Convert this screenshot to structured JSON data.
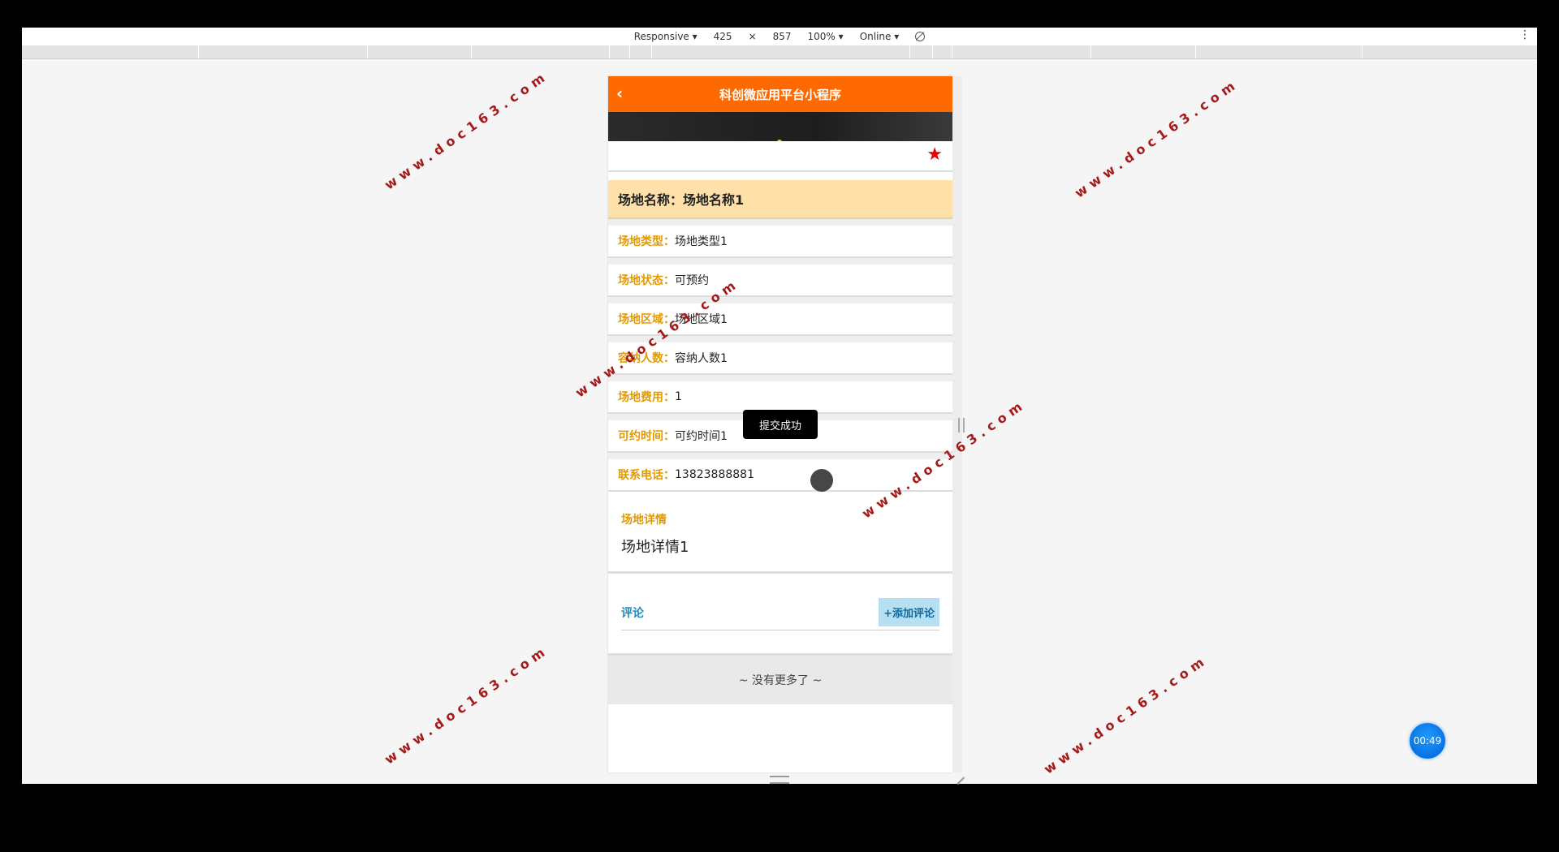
{
  "devtools": {
    "mode": "Responsive ▾",
    "width": "425",
    "times": "×",
    "height": "857",
    "zoom": "100% ▾",
    "network": "Online ▾",
    "menu": "⋮"
  },
  "app": {
    "title": "科创微应用平台小程序",
    "back_icon": "‹"
  },
  "venue": {
    "name_text": "场地名称：场地名称1",
    "fields": [
      {
        "label": "场地类型：",
        "value": "场地类型1"
      },
      {
        "label": "场地状态：",
        "value": "可预约"
      },
      {
        "label": "场地区域：",
        "value": "场地区域1"
      },
      {
        "label": "容纳人数：",
        "value": "容纳人数1"
      },
      {
        "label": "场地费用：",
        "value": "1"
      },
      {
        "label": "可约时间：",
        "value": "可约时间1"
      },
      {
        "label": "联系电话：",
        "value": "13823888881"
      }
    ],
    "detail_label": "场地详情",
    "detail_value": "场地详情1"
  },
  "comments": {
    "label": "评论",
    "add_button": "+添加评论",
    "no_more": "~ 没有更多了 ~"
  },
  "toast": "提交成功",
  "timer": "00:49",
  "watermark": "www.doc163.com",
  "colors": {
    "header": "#ff6a00",
    "name_bg": "#ffe0a8",
    "field_label": "#e39a00",
    "comment_label": "#1c8cc2",
    "star": "#e60000"
  }
}
